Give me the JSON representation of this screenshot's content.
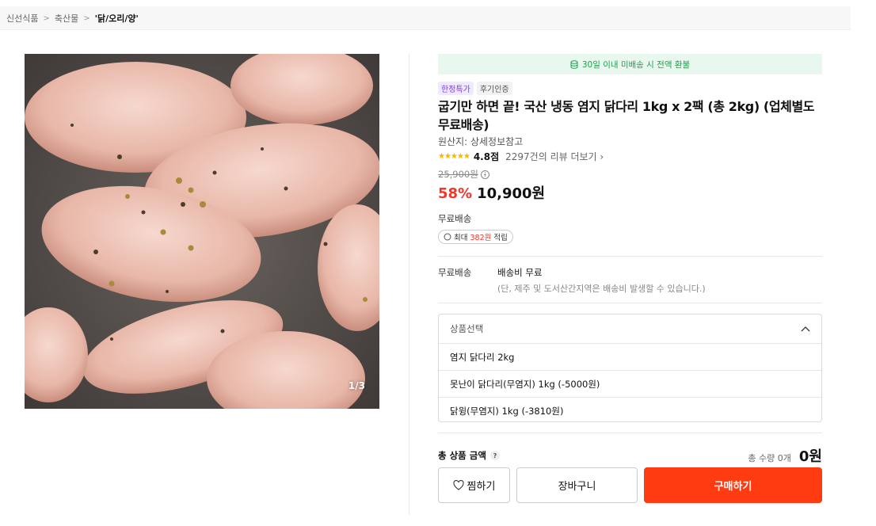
{
  "breadcrumb": [
    "신선식품",
    "축산물",
    "'닭/오리/양'"
  ],
  "gallery": {
    "counter": "1/3"
  },
  "notice": {
    "text": "30일 이내 미배송 시 전액 환불"
  },
  "badges": [
    "한정특가",
    "후기인증"
  ],
  "product": {
    "title": "굽기만 하면 끝! 국산 냉동 염지 닭다리 1kg x 2팩 (총 2kg) (업체별도 무료배송)",
    "origin": "원산지: 상세정보참고",
    "stars": "★★★★★",
    "rating_score": 4.8,
    "score_label": "4.8점",
    "review_link": "2297건의 리뷰 더보기",
    "original_price": "25,900원",
    "discount": "58%",
    "price": "10,900원"
  },
  "shipping": {
    "label": "무료배송",
    "points_prefix": "최대",
    "points_value": "382원",
    "points_suffix": "적립",
    "detail_key": "무료배송",
    "detail_value": "배송비 무료",
    "detail_note": "(단, 제주 및 도서산간지역은 배송비 발생할 수 있습니다.)"
  },
  "options": {
    "placeholder": "상품선택",
    "items": [
      "염지 닭다리 2kg",
      "못난이 닭다리(무염지) 1kg (-5000원)",
      "닭윙(무염지) 1kg (-3810원)"
    ]
  },
  "total": {
    "label": "총 상품 금액",
    "help": "?",
    "qty": "총 수량 0개",
    "price": "0원"
  },
  "buttons": {
    "wish": "찜하기",
    "cart": "장바구니",
    "buy": "구매하기"
  },
  "colors": {
    "accent": "#ff3b12",
    "discount": "#f5372a",
    "notice_bg": "#e9f8ee",
    "notice_text": "#14a24a"
  }
}
